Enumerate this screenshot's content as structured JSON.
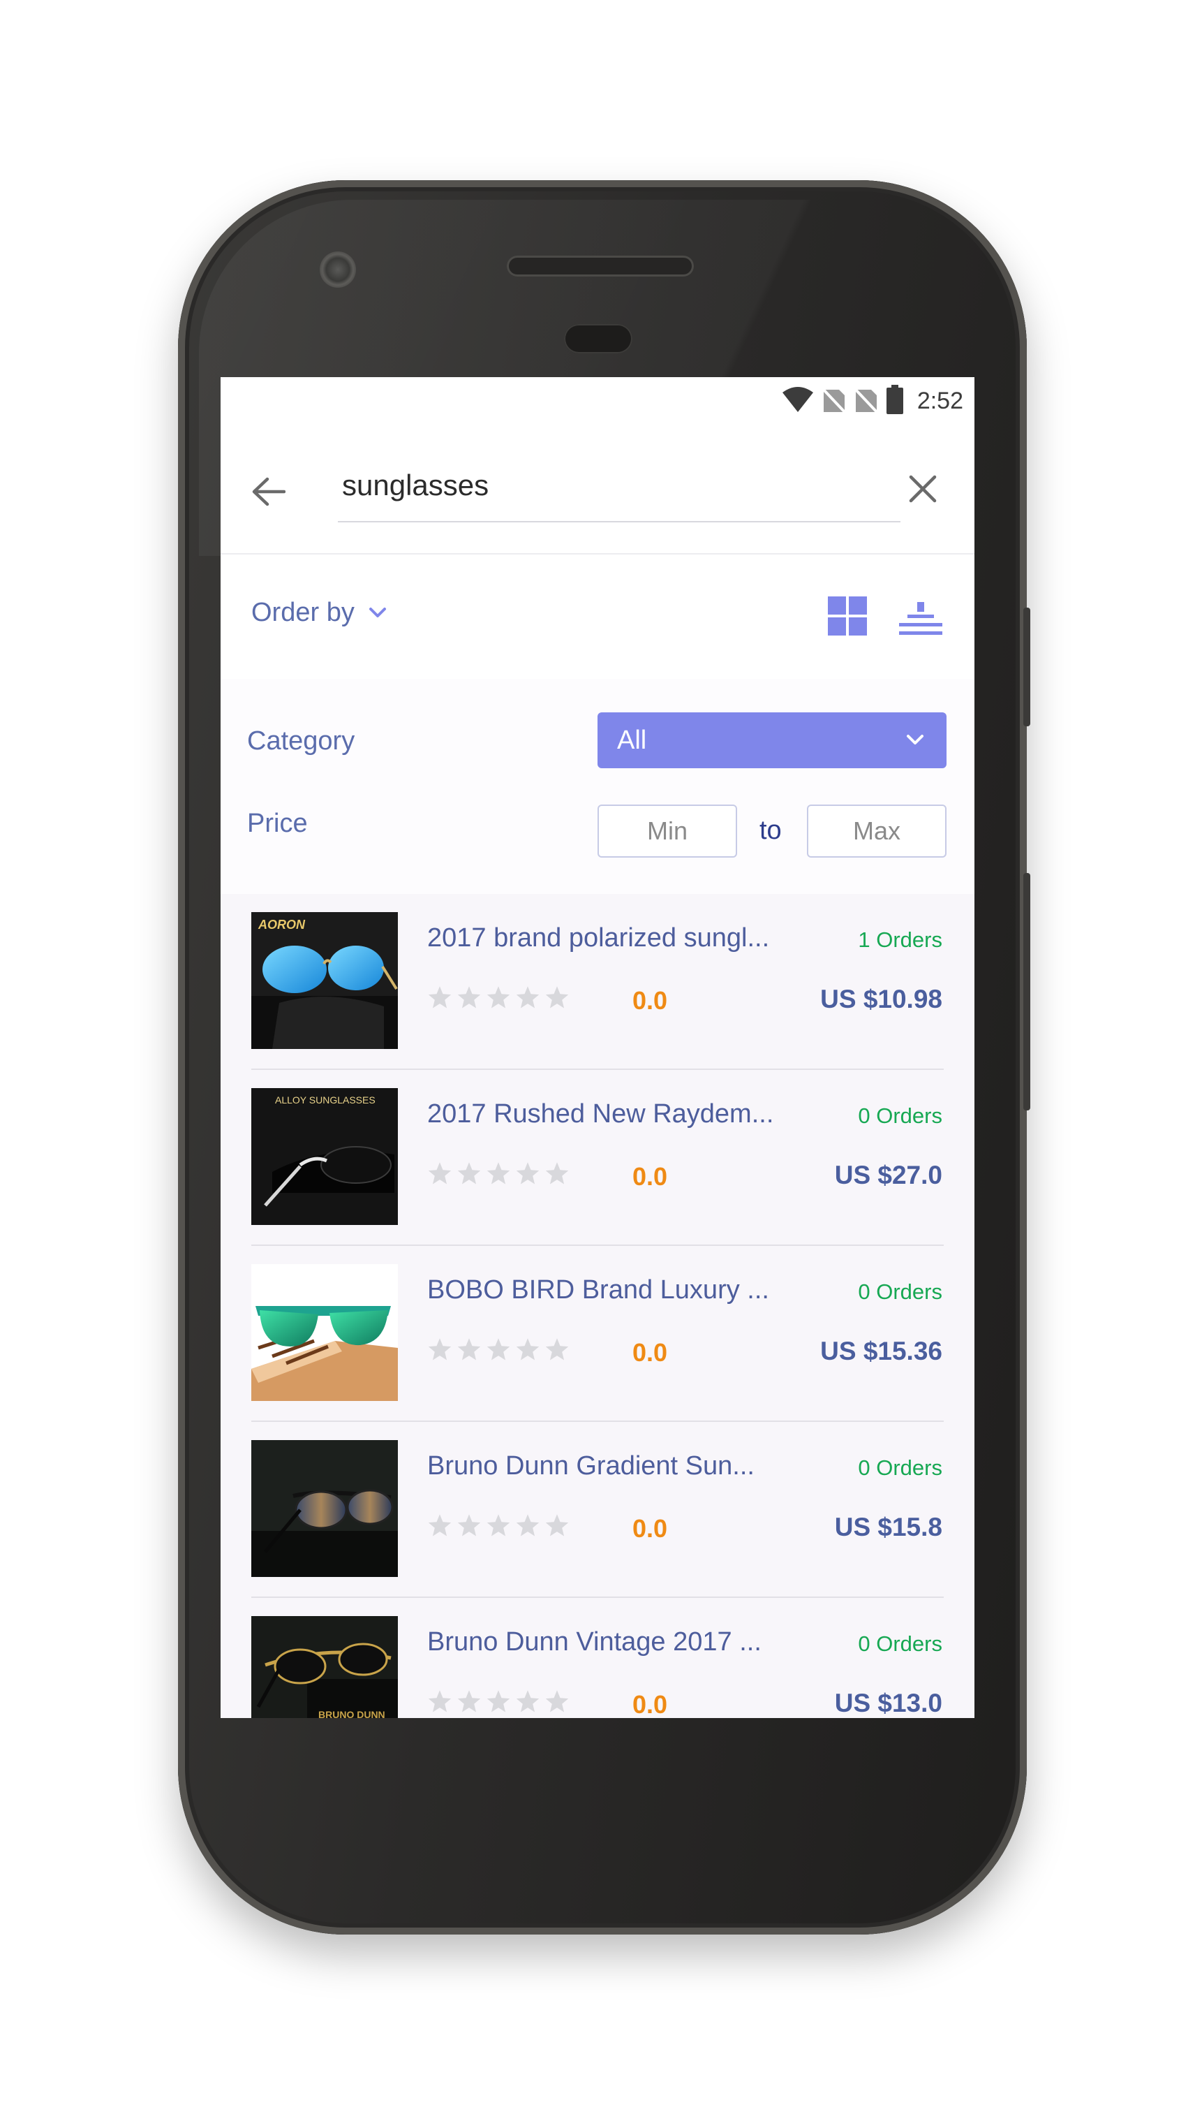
{
  "statusbar": {
    "time": "2:52",
    "icons": [
      "wifi-icon",
      "sim-off-icon",
      "sim-off-icon",
      "battery-icon"
    ]
  },
  "search": {
    "query": "sunglasses",
    "back_icon": "arrow-left-icon",
    "clear_icon": "close-icon"
  },
  "toolbar": {
    "order_by_label": "Order by",
    "view_icons": [
      "grid-view-icon",
      "list-view-icon"
    ]
  },
  "filters": {
    "category_label": "Category",
    "category_value": "All",
    "price_label": "Price",
    "min_placeholder": "Min",
    "to_label": "to",
    "max_placeholder": "Max",
    "accent_color": "#7f86ea"
  },
  "products": [
    {
      "title": "2017 brand polarized sungl...",
      "orders": "1 Orders",
      "rating": "0.0",
      "price": "US $10.98",
      "stars": 0
    },
    {
      "title": "2017 Rushed New Raydem...",
      "orders": "0 Orders",
      "rating": "0.0",
      "price": "US $27.0",
      "stars": 0
    },
    {
      "title": "BOBO BIRD Brand Luxury ...",
      "orders": "0 Orders",
      "rating": "0.0",
      "price": "US $15.36",
      "stars": 0
    },
    {
      "title": "Bruno Dunn Gradient Sun...",
      "orders": "0 Orders",
      "rating": "0.0",
      "price": "US $15.8",
      "stars": 0
    },
    {
      "title": "Bruno Dunn Vintage 2017 ...",
      "orders": "0 Orders",
      "rating": "0.0",
      "price": "US $13.0",
      "stars": 0
    }
  ],
  "thumb_labels": {
    "p0_brand": "AORON",
    "p1_caption": "ALLOY SUNGLASSES",
    "p4_brand": "BRUNO DUNN"
  }
}
